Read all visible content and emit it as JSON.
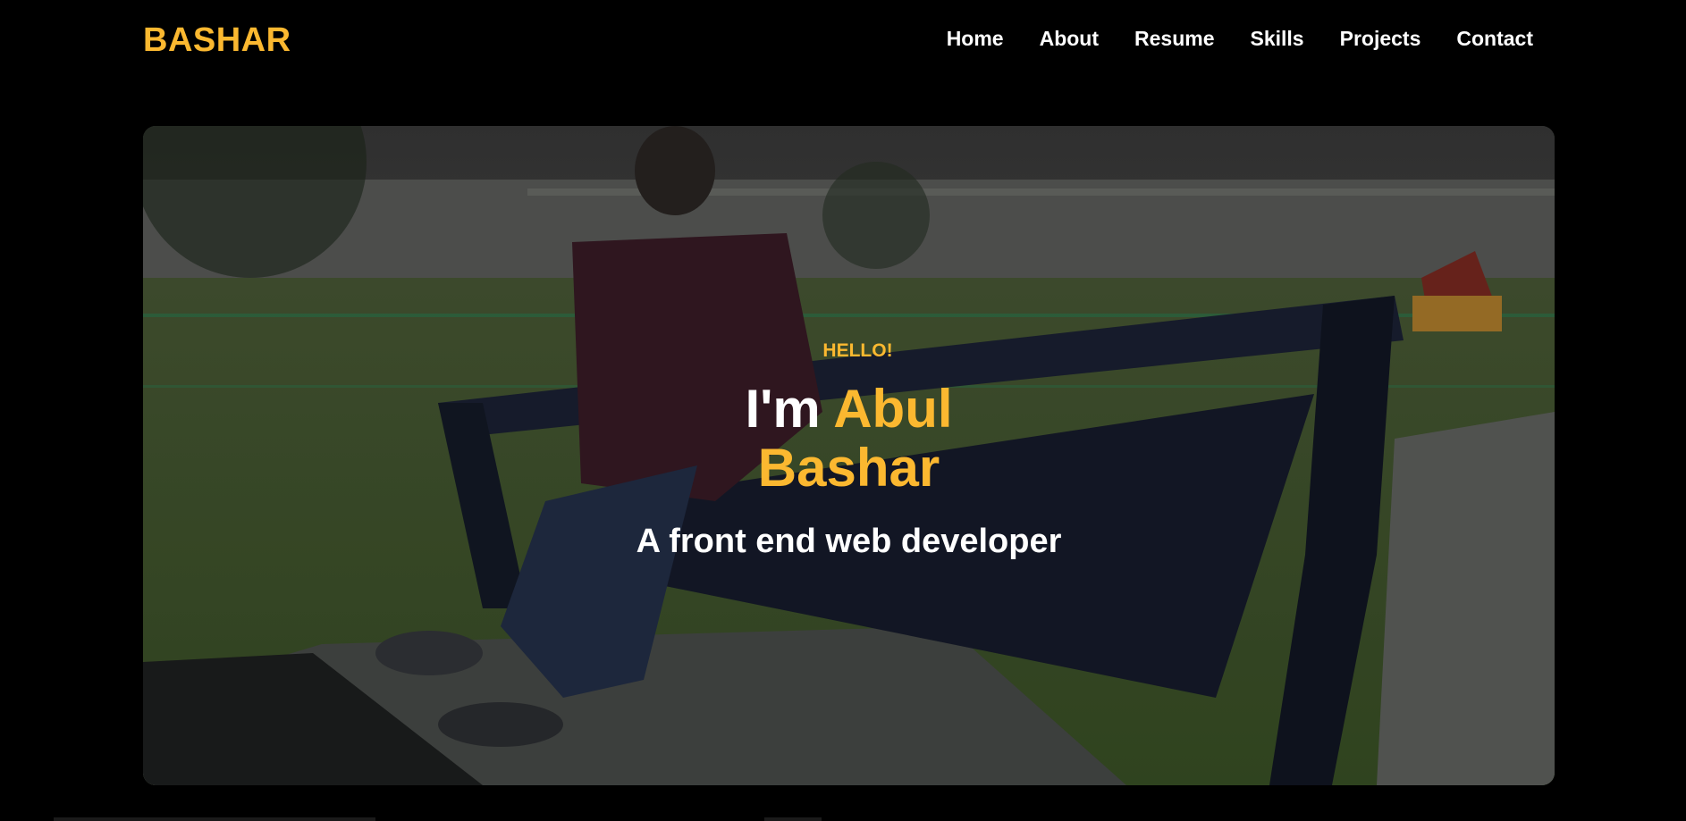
{
  "nav": {
    "brand": "BASHAR",
    "links": [
      "Home",
      "About",
      "Resume",
      "Skills",
      "Projects",
      "Contact"
    ]
  },
  "hero": {
    "greeting": "HELLO!",
    "name_prefix": "I'm",
    "name_first": "Abul",
    "name_last": "Bashar",
    "subtitle": "A front end web developer",
    "background_image": "photo-person-sitting-on-bench-by-river"
  },
  "colors": {
    "accent": "#fbb830",
    "background": "#000000",
    "text": "#ffffff"
  }
}
